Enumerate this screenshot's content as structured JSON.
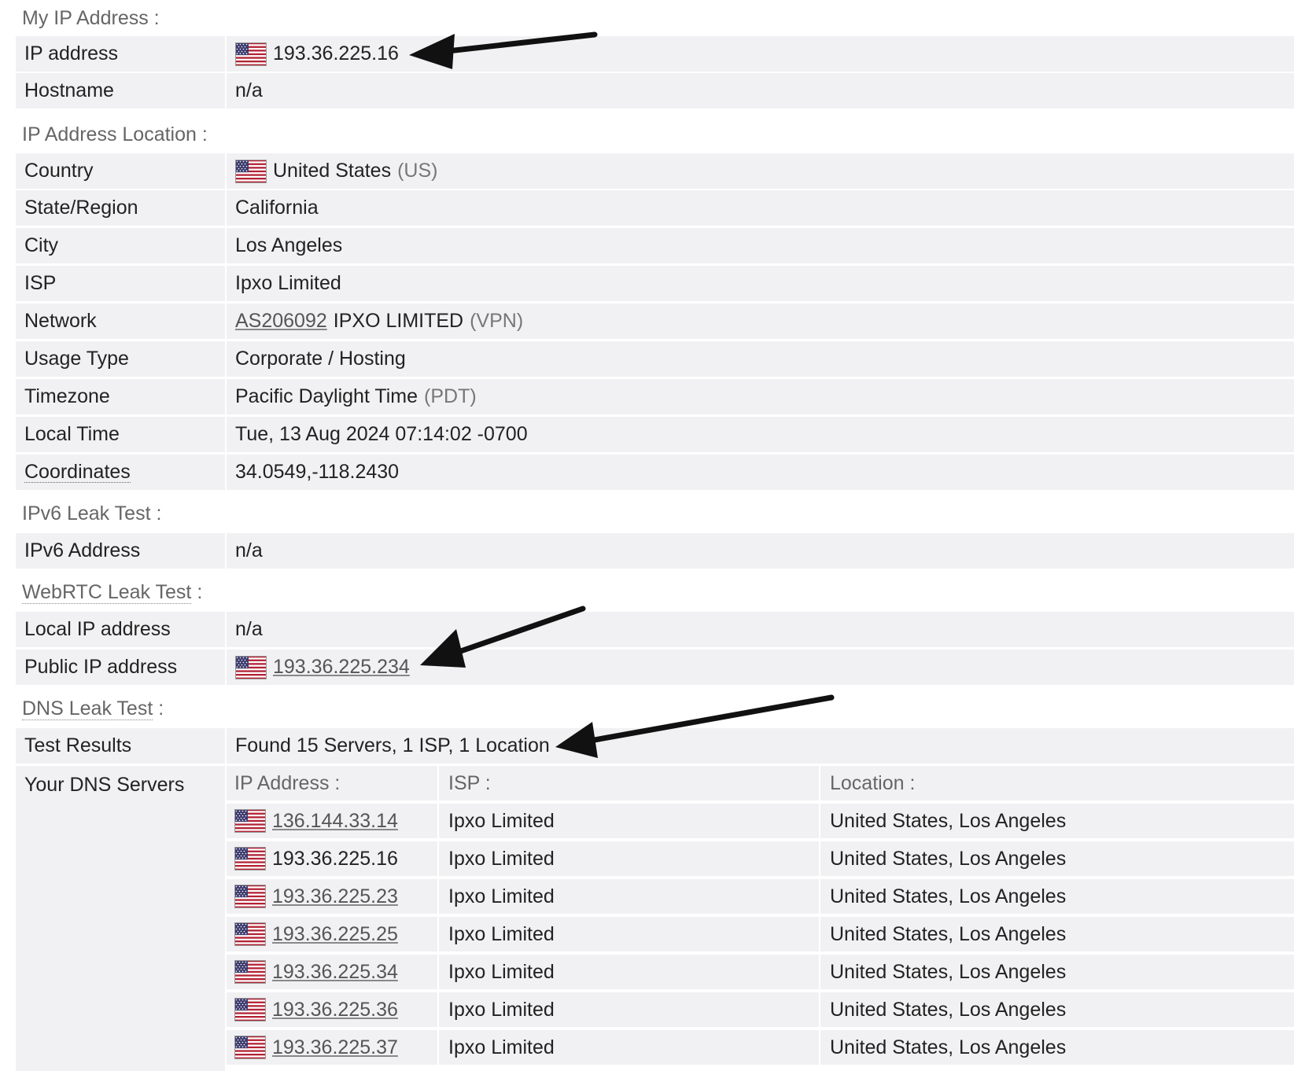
{
  "sections": {
    "my_ip": "My IP Address :",
    "location": "IP Address Location :",
    "ipv6": "IPv6 Leak Test :",
    "webrtc": "WebRTC Leak Test",
    "webrtc_colon": " :",
    "dns": "DNS Leak Test",
    "dns_colon": " :"
  },
  "my_ip": {
    "ip_label": "IP address",
    "ip_value": "193.36.225.16",
    "hostname_label": "Hostname",
    "hostname_value": "n/a"
  },
  "location": {
    "country_label": "Country",
    "country_value": "United States",
    "country_code": "(US)",
    "state_label": "State/Region",
    "state_value": "California",
    "city_label": "City",
    "city_value": "Los Angeles",
    "isp_label": "ISP",
    "isp_value": "Ipxo Limited",
    "network_label": "Network",
    "network_asn": "AS206092",
    "network_name": "IPXO LIMITED",
    "network_type": "(VPN)",
    "usage_label": "Usage Type",
    "usage_value": "Corporate / Hosting",
    "timezone_label": "Timezone",
    "timezone_value": "Pacific Daylight Time",
    "timezone_code": "(PDT)",
    "localtime_label": "Local Time",
    "localtime_value": "Tue, 13 Aug 2024 07:14:02 -0700",
    "coords_label": "Coordinates",
    "coords_value": "34.0549,-118.2430"
  },
  "ipv6": {
    "label": "IPv6 Address",
    "value": "n/a"
  },
  "webrtc": {
    "local_label": "Local IP address",
    "local_value": "n/a",
    "public_label": "Public IP address",
    "public_value": "193.36.225.234"
  },
  "dns": {
    "results_label": "Test Results",
    "results_value": "Found 15 Servers, 1 ISP, 1 Location",
    "servers_label": "Your DNS Servers",
    "col_ip": "IP Address :",
    "col_isp": "ISP :",
    "col_location": "Location :",
    "servers": [
      {
        "ip": "136.144.33.14",
        "isp": "Ipxo Limited",
        "location": "United States, Los Angeles"
      },
      {
        "ip": "193.36.225.16",
        "isp": "Ipxo Limited",
        "location": "United States, Los Angeles"
      },
      {
        "ip": "193.36.225.23",
        "isp": "Ipxo Limited",
        "location": "United States, Los Angeles"
      },
      {
        "ip": "193.36.225.25",
        "isp": "Ipxo Limited",
        "location": "United States, Los Angeles"
      },
      {
        "ip": "193.36.225.34",
        "isp": "Ipxo Limited",
        "location": "United States, Los Angeles"
      },
      {
        "ip": "193.36.225.36",
        "isp": "Ipxo Limited",
        "location": "United States, Los Angeles"
      },
      {
        "ip": "193.36.225.37",
        "isp": "Ipxo Limited",
        "location": "United States, Los Angeles"
      }
    ]
  },
  "icons": {
    "flag": "us-flag-icon",
    "arrow": "arrow-annotation-icon"
  }
}
